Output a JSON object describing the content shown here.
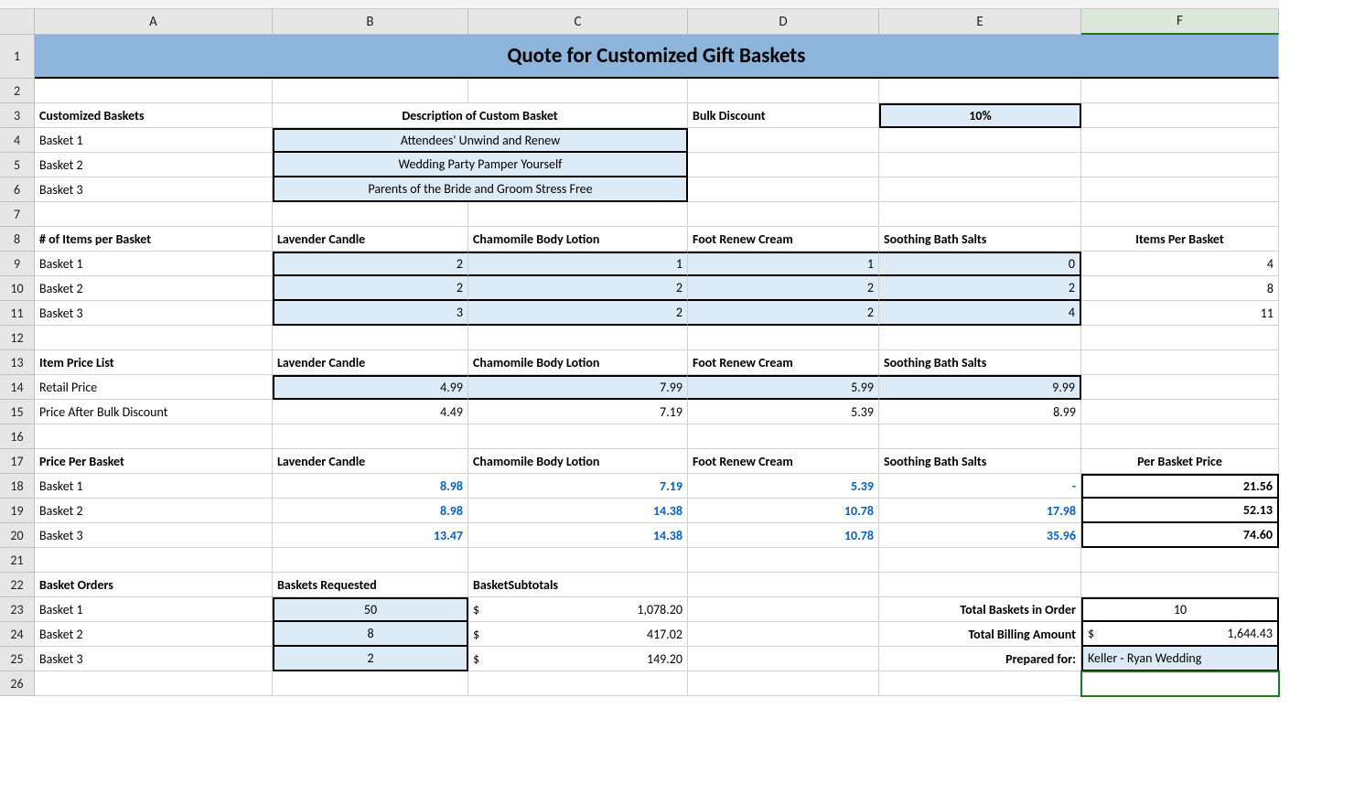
{
  "columns": [
    "A",
    "B",
    "C",
    "D",
    "E",
    "F"
  ],
  "row_numbers": [
    "1",
    "2",
    "3",
    "4",
    "5",
    "6",
    "7",
    "8",
    "9",
    "10",
    "11",
    "12",
    "13",
    "14",
    "15",
    "16",
    "17",
    "18",
    "19",
    "20",
    "21",
    "22",
    "23",
    "24",
    "25",
    "26"
  ],
  "title": "Quote for Customized Gift Baskets",
  "labels": {
    "custom_baskets": "Customized Baskets",
    "desc": "Description of Custom Basket",
    "bulk_discount": "Bulk Discount",
    "b1": "Basket 1",
    "b2": "Basket 2",
    "b3": "Basket 3",
    "items_per_basket_hdr": "# of Items per Basket",
    "lav": "Lavender Candle",
    "cham": "Chamomile Body Lotion",
    "foot": "Foot Renew Cream",
    "salts": "Soothing Bath Salts",
    "items_per_basket": "Items Per Basket",
    "price_list": "Item Price List",
    "retail": "Retail Price",
    "after_disc": "Price After Bulk Discount",
    "price_per_basket": "Price Per Basket",
    "per_basket_price": "Per Basket Price",
    "basket_orders": "Basket Orders",
    "baskets_req": "Baskets Requested",
    "basket_sub": "BasketSubtotals",
    "total_baskets": "Total Baskets in Order",
    "total_billing": "Total Billing Amount",
    "prepared_for": "Prepared for:"
  },
  "values": {
    "discount": "10%",
    "desc1": "Attendees' Unwind and Renew",
    "desc2": "Wedding Party Pamper Yourself",
    "desc3": "Parents of the Bride and Groom Stress Free",
    "items": {
      "b1": {
        "lav": "2",
        "cham": "1",
        "foot": "1",
        "salts": "0",
        "total": "4"
      },
      "b2": {
        "lav": "2",
        "cham": "2",
        "foot": "2",
        "salts": "2",
        "total": "8"
      },
      "b3": {
        "lav": "3",
        "cham": "2",
        "foot": "2",
        "salts": "4",
        "total": "11"
      }
    },
    "retail": {
      "lav": "4.99",
      "cham": "7.99",
      "foot": "5.99",
      "salts": "9.99"
    },
    "after": {
      "lav": "4.49",
      "cham": "7.19",
      "foot": "5.39",
      "salts": "8.99"
    },
    "ppb": {
      "b1": {
        "lav": "8.98",
        "cham": "7.19",
        "foot": "5.39",
        "salts": "-",
        "total": "21.56"
      },
      "b2": {
        "lav": "8.98",
        "cham": "14.38",
        "foot": "10.78",
        "salts": "17.98",
        "total": "52.13"
      },
      "b3": {
        "lav": "13.47",
        "cham": "14.38",
        "foot": "10.78",
        "salts": "35.96",
        "total": "74.60"
      }
    },
    "orders": {
      "b1": {
        "req": "50",
        "sub": "1,078.20"
      },
      "b2": {
        "req": "8",
        "sub": "417.02"
      },
      "b3": {
        "req": "2",
        "sub": "149.20"
      }
    },
    "total_baskets": "10",
    "total_billing": "1,644.43",
    "prepared_for": "Keller - Ryan Wedding",
    "dollar": "$"
  }
}
